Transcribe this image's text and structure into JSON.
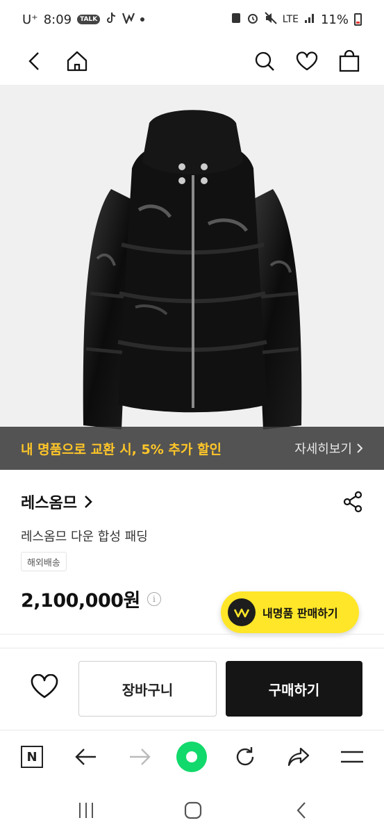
{
  "status_bar": {
    "carrier": "U⁺",
    "time": "8:09",
    "talk_badge": "TALK",
    "network": "LTE",
    "battery": "11%"
  },
  "promo": {
    "text": "내 명품으로 교환 시, 5% 추가 할인",
    "link": "자세히보기"
  },
  "product": {
    "brand": "레스옴므",
    "name": "레스옴므 다운 합성 패딩",
    "tag": "해외배송",
    "price": "2,100,000원"
  },
  "sell_fab": {
    "label": "내명품 판매하기"
  },
  "actions": {
    "cart": "장바구니",
    "buy": "구매하기"
  },
  "browser_bar": {
    "n_label": "N"
  },
  "colors": {
    "promo_text": "#ffc629",
    "fab": "#ffe628",
    "buy_button": "#151515",
    "browser_green": "#12d96b"
  }
}
